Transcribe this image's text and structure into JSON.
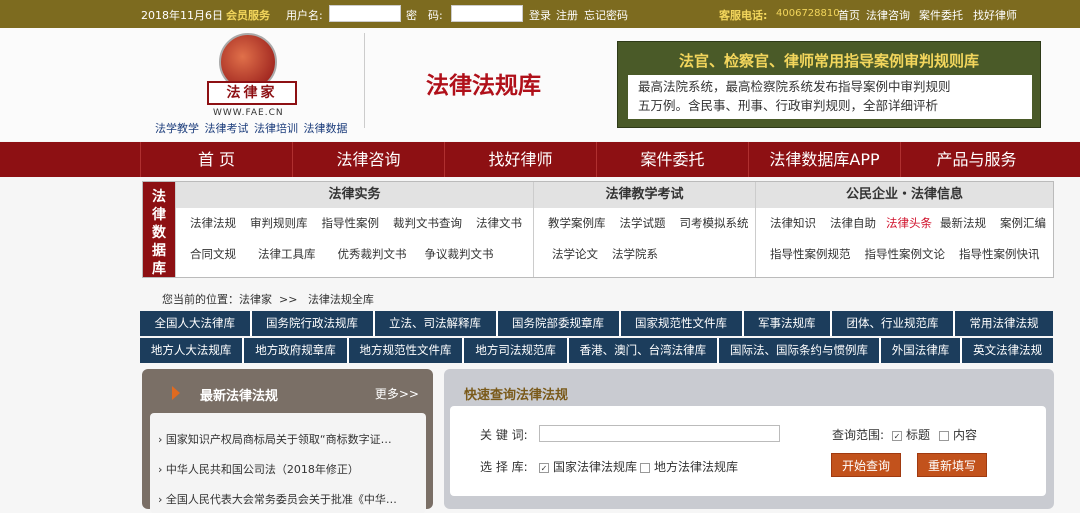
{
  "topbar": {
    "date": "2018年11月6日",
    "member": "会员服务",
    "user_label": "用户名:",
    "pwd_label": "密　码:",
    "login": "登录",
    "register": "注册",
    "forgot": "忘记密码",
    "hotline": "客服电话:",
    "phone": "4006728810",
    "links": [
      "首页",
      "法律咨询",
      "案件委托",
      "找好律师"
    ]
  },
  "header": {
    "logo_text": "法律家",
    "logo_url": "WWW.FAE.CN",
    "logo_links": [
      "法学教学",
      "法律考试",
      "法律培训",
      "法律数据"
    ],
    "title": "法律法规库",
    "banner_title": "法官、检察官、律师常用指导案例审判规则库",
    "banner_line1": "最高法院系统，最高检察院系统发布指导案例中审判规则",
    "banner_line2": "五万例。含民事、刑事、行政审判规则，全部详细评析"
  },
  "nav": [
    "首 页",
    "法律咨询",
    "找好律师",
    "案件委托",
    "法律数据库APP",
    "产品与服务"
  ],
  "cat": {
    "side": [
      "法",
      "律",
      "数",
      "据",
      "库"
    ],
    "cols": [
      {
        "title": "法律实务",
        "rows": [
          [
            "法律法规",
            "审判规则库",
            "指导性案例",
            "裁判文书查询",
            "法律文书"
          ],
          [
            "合同文规",
            "法律工具库",
            "优秀裁判文书",
            "争议裁判文书"
          ]
        ]
      },
      {
        "title": "法律教学考试",
        "rows": [
          [
            "教学案例库",
            "法学试题",
            "司考模拟系统"
          ],
          [
            "法学论文",
            "法学院系"
          ]
        ]
      },
      {
        "title": "公民企业・法律信息",
        "rows": [
          [
            "法律知识",
            "法律自助",
            "法律头条",
            "最新法规",
            "案例汇编"
          ],
          [
            "指导性案例规范",
            "指导性案例文论",
            "指导性案例快讯"
          ]
        ]
      }
    ]
  },
  "crumb": {
    "label": "您当前的位置：",
    "home": "法律家",
    "sep": ">>",
    "current": "法律法规全库"
  },
  "row1": [
    "全国人大法律库",
    "国务院行政法规库",
    "立法、司法解释库",
    "国务院部委规章库",
    "国家规范性文件库",
    "军事法规库",
    "团体、行业规范库",
    "常用法律法规"
  ],
  "row2": [
    "地方人大法规库",
    "地方政府规章库",
    "地方规范性文件库",
    "地方司法规范库",
    "香港、澳门、台湾法律库",
    "国际法、国际条约与惯例库",
    "外国法律库",
    "英文法律法规"
  ],
  "news": {
    "title": "最新法律法规",
    "more": "更多>>",
    "items": [
      "国家知识产权局商标局关于领取“商标数字证…",
      "中华人民共和国公司法（2018年修正）",
      "全国人民代表大会常务委员会关于批准《中华…"
    ]
  },
  "search": {
    "title": "快速查询法律法规",
    "kw": "关 键 词:",
    "scope": "查询范围:",
    "opt_title": "标题",
    "opt_content": "内容",
    "lib": "选 择 库:",
    "lib_nat": "国家法律法规库",
    "lib_local": "地方法律法规库",
    "go": "开始查询",
    "reset": "重新填写"
  },
  "colors": {
    "olive": "#7d6b1f",
    "red": "#8d1013",
    "navy": "#1c3d5c",
    "highlight": "#d0102a"
  }
}
